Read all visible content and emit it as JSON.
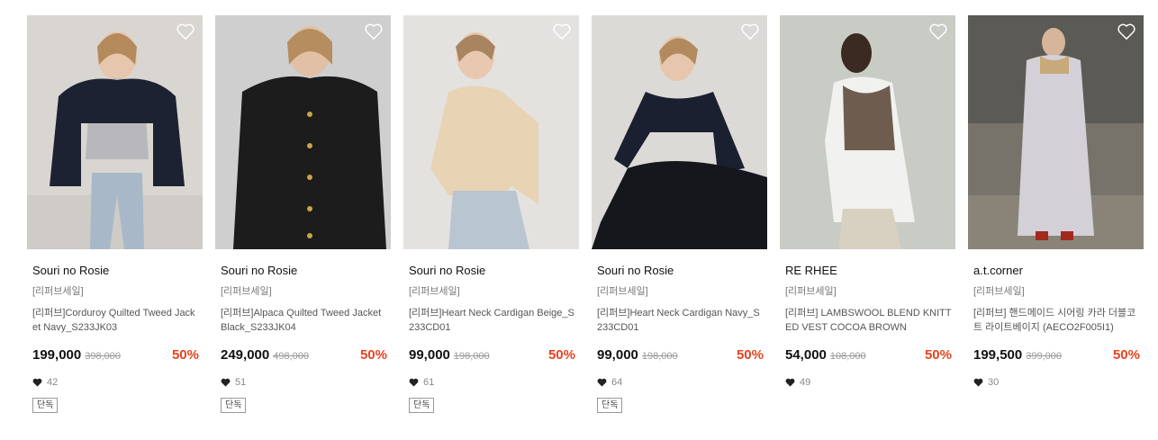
{
  "products": [
    {
      "brand": "Souri no Rosie",
      "tag": "[리퍼브세일]",
      "description": "[리퍼브]Corduroy Quilted Tweed Jacket Navy_S233JK03",
      "price": "199,000",
      "original_price": "398,000",
      "discount": "50%",
      "likes": "42",
      "badge": "단독",
      "icon_wishlist": "heart-outline-icon",
      "icon_likes": "heart-filled-icon"
    },
    {
      "brand": "Souri no Rosie",
      "tag": "[리퍼브세일]",
      "description": "[리퍼브]Alpaca Quilted Tweed Jacket Black_S233JK04",
      "price": "249,000",
      "original_price": "498,000",
      "discount": "50%",
      "likes": "51",
      "badge": "단독",
      "icon_wishlist": "heart-outline-icon",
      "icon_likes": "heart-filled-icon"
    },
    {
      "brand": "Souri no Rosie",
      "tag": "[리퍼브세일]",
      "description": "[리퍼브]Heart Neck Cardigan Beige_S233CD01",
      "price": "99,000",
      "original_price": "198,000",
      "discount": "50%",
      "likes": "61",
      "badge": "단독",
      "icon_wishlist": "heart-outline-icon",
      "icon_likes": "heart-filled-icon"
    },
    {
      "brand": "Souri no Rosie",
      "tag": "[리퍼브세일]",
      "description": "[리퍼브]Heart Neck Cardigan Navy_S233CD01",
      "price": "99,000",
      "original_price": "198,000",
      "discount": "50%",
      "likes": "64",
      "badge": "단독",
      "icon_wishlist": "heart-outline-icon",
      "icon_likes": "heart-filled-icon"
    },
    {
      "brand": "RE RHEE",
      "tag": "[리퍼브세일]",
      "description": "[리퍼브] LAMBSWOOL BLEND KNITTED VEST COCOA BROWN",
      "price": "54,000",
      "original_price": "108,000",
      "discount": "50%",
      "likes": "49",
      "badge": "",
      "icon_wishlist": "heart-outline-icon",
      "icon_likes": "heart-filled-icon"
    },
    {
      "brand": "a.t.corner",
      "tag": "[리퍼브세일]",
      "description": "[리퍼브] 핸드메이드 시어링 카라 더블코트 라이트베이지 (AECO2F005I1)",
      "price": "199,500",
      "original_price": "399,000",
      "discount": "50%",
      "likes": "30",
      "badge": "",
      "icon_wishlist": "heart-outline-icon",
      "icon_likes": "heart-filled-icon"
    }
  ],
  "colors": {
    "discount": "#e8431e",
    "price": "#111111",
    "original_price": "#999999"
  }
}
